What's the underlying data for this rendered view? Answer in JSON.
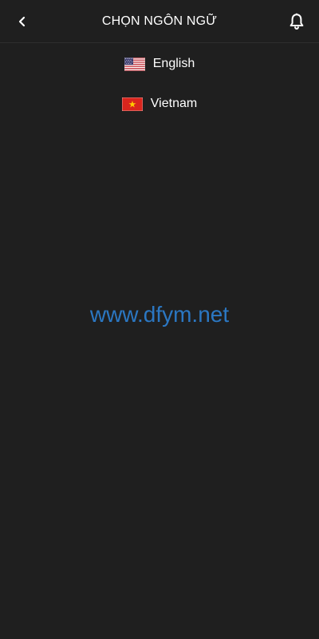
{
  "header": {
    "title": "CHỌN NGÔN NGỮ",
    "back_icon": "chevron-left-icon",
    "bell_icon": "bell-icon"
  },
  "languages": [
    {
      "label": "English",
      "flag": "us-flag-icon"
    },
    {
      "label": "Vietnam",
      "flag": "vn-flag-icon"
    }
  ],
  "watermark": "www.dfym.net",
  "colors": {
    "background": "#1f1f1f",
    "text": "#ffffff",
    "watermark": "#2b77c2"
  }
}
